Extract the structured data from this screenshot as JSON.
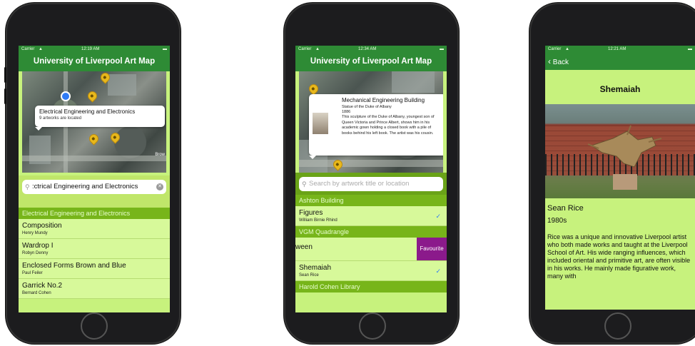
{
  "status": {
    "carrier": "Carrier",
    "phone1_time": "12:19 AM",
    "phone2_time": "12:34 AM",
    "phone3_time": "12:21 AM"
  },
  "phone1": {
    "nav_title": "University of Liverpool Art Map",
    "callout": {
      "title": "Electrical Engineering and Electronics",
      "subtitle": "9 artworks are located"
    },
    "map_label": "Brow",
    "search_value": ":ctrical Engineering and Electronics",
    "section": "Electrical Engineering and Electronics",
    "rows": [
      {
        "title": "Composition",
        "artist": "Henry Mundy"
      },
      {
        "title": "Wardrop I",
        "artist": "Robyn Denny"
      },
      {
        "title": "Enclosed Forms Brown and Blue",
        "artist": "Paul Feiler"
      },
      {
        "title": "Garrick No.2",
        "artist": "Bernard Cohen"
      }
    ]
  },
  "phone2": {
    "nav_title": "University of Liverpool Art Map",
    "callout": {
      "title": "Mechanical Engineering Building",
      "line1": "Statue of the Duke of Albany",
      "line2": "1886",
      "body": "This sculpture of the Duke of Albany, youngest son of Queen Victoria and Prince Albert, shows him in his academic gown holding a closed book with a pile of books behind his left book.  The artist was his cousin."
    },
    "search_placeholder": "Search by artwork title or location",
    "sections": [
      {
        "header": "Ashton Building"
      },
      {
        "header": "VGM Quadrangle"
      },
      {
        "header": "Harold Cohen Library"
      }
    ],
    "rows": [
      {
        "title": "Figures",
        "artist": "William Birnie Rhind",
        "checked": "✓"
      },
      {
        "title": "ween",
        "artist": "",
        "action": "Favourite"
      },
      {
        "title": "Shemaiah",
        "artist": "Sean Rice",
        "checked": "✓"
      }
    ]
  },
  "phone3": {
    "back_label": "Back",
    "title": "Shemaiah",
    "artist": "Sean Rice",
    "year": "1980s",
    "bio": "Rice was a unique and innovative Liverpool artist who both made works and taught at the Liverpool School of Art.  His wide ranging influences, which included oriental and primitive art, are often visible in his works.  He mainly made figurative work, many with"
  },
  "colors": {
    "nav_green": "#2e8b35",
    "screen_bg": "#c7f27d",
    "section_green": "#77b51a",
    "favourite_purple": "#8b1a8b",
    "pin_yellow": "#e8b81c",
    "check_blue": "#2f7bf5"
  }
}
